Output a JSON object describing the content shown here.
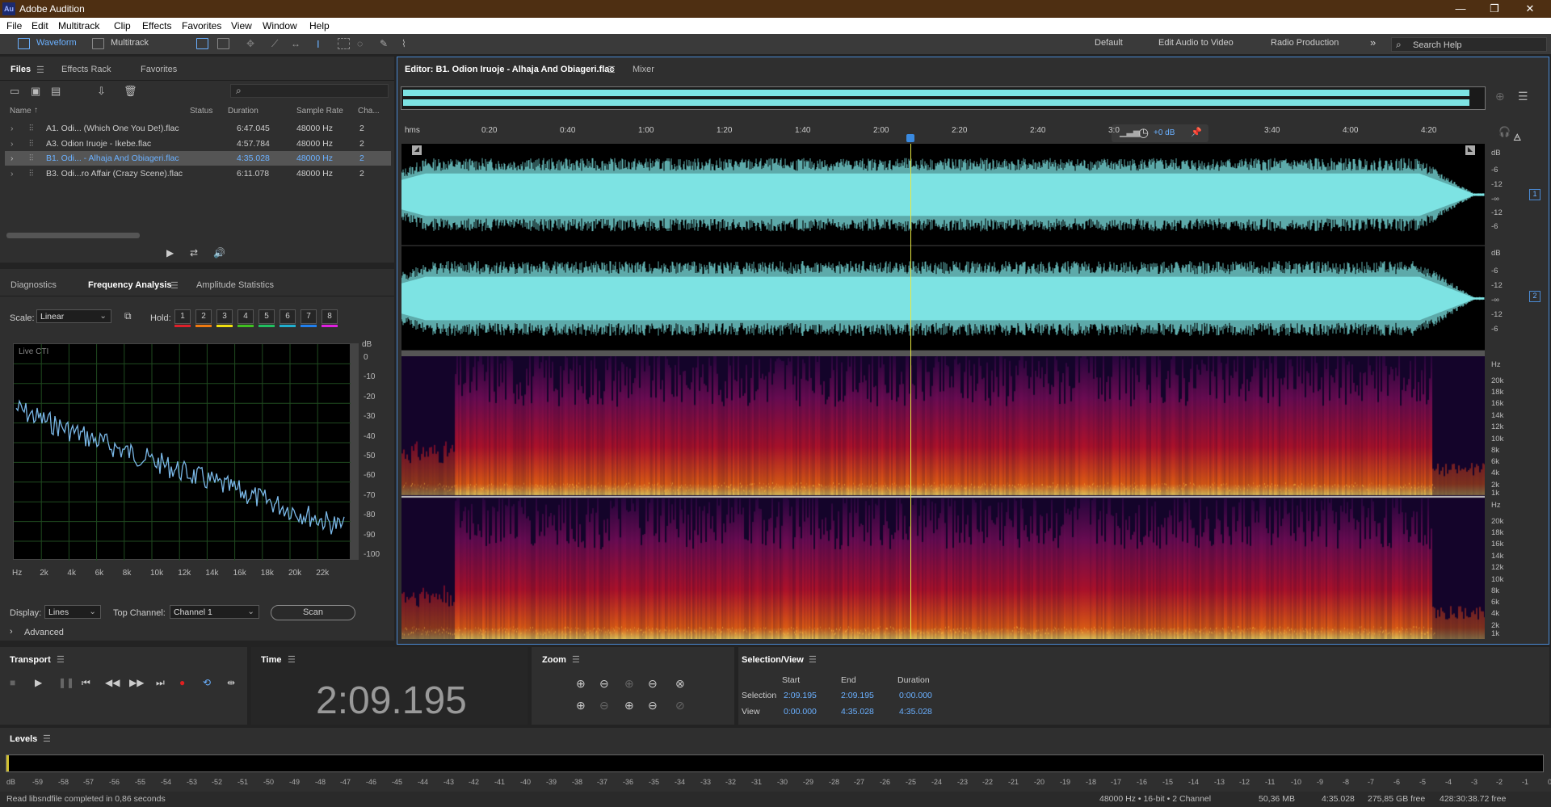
{
  "app": {
    "title": "Adobe Audition",
    "logo_text": "Au",
    "window_buttons": [
      "—",
      "❐",
      "✕"
    ]
  },
  "menu": [
    "File",
    "Edit",
    "Multitrack",
    "Clip",
    "Effects",
    "Favorites",
    "View",
    "Window",
    "Help"
  ],
  "toolbar": {
    "waveform_label": "Waveform",
    "multitrack_label": "Multitrack",
    "workspaces": [
      "Default",
      "Edit Audio to Video",
      "Radio Production"
    ],
    "more": "»",
    "search_placeholder": "Search Help"
  },
  "files_panel": {
    "tabs": [
      "Files",
      "Effects Rack",
      "Favorites"
    ],
    "search_icon": "⌕",
    "columns": [
      "Name",
      "Status",
      "Duration",
      "Sample Rate",
      "Cha..."
    ],
    "sort_arrow": "↑",
    "rows": [
      {
        "name": "A1. Odi... (Which One You De!).flac",
        "duration": "6:47.045",
        "rate": "48000 Hz",
        "ch": "2",
        "selected": false
      },
      {
        "name": "A3. Odion Iruoje - Ikebe.flac",
        "duration": "4:57.784",
        "rate": "48000 Hz",
        "ch": "2",
        "selected": false
      },
      {
        "name": "B1. Odi... - Alhaja And Obiageri.flac",
        "duration": "4:35.028",
        "rate": "48000 Hz",
        "ch": "2",
        "selected": true
      },
      {
        "name": "B3. Odi...ro Affair (Crazy Scene).flac",
        "duration": "6:11.078",
        "rate": "48000 Hz",
        "ch": "2",
        "selected": false
      }
    ]
  },
  "analysis_panel": {
    "tabs": [
      "Diagnostics",
      "Frequency Analysis",
      "Amplitude Statistics"
    ],
    "scale_label": "Scale:",
    "scale_value": "Linear",
    "hold_label": "Hold:",
    "hold_buttons": [
      "1",
      "2",
      "3",
      "4",
      "5",
      "6",
      "7",
      "8"
    ],
    "hold_colors": [
      "#e0202a",
      "#f07a10",
      "#f0e010",
      "#40c020",
      "#20c060",
      "#20b0d0",
      "#2080f0",
      "#e020e0"
    ],
    "live_cti": "Live CTI",
    "db_label": "dB",
    "db_ticks": [
      "0",
      "-10",
      "-20",
      "-30",
      "-40",
      "-50",
      "-60",
      "-70",
      "-80",
      "-90",
      "-100"
    ],
    "hz_ticks": [
      "Hz",
      "2k",
      "4k",
      "6k",
      "8k",
      "10k",
      "12k",
      "14k",
      "16k",
      "18k",
      "20k",
      "22k"
    ],
    "display_label": "Display:",
    "display_value": "Lines",
    "top_channel_label": "Top Channel:",
    "top_channel_value": "Channel 1",
    "scan_label": "Scan",
    "advanced_label": "Advanced"
  },
  "editor": {
    "tab_label": "Editor: B1. Odion Iruoje - Alhaja And Obiageri.flac",
    "mixer_label": "Mixer",
    "timeline_unit": "hms",
    "timeline_ticks": [
      "0:20",
      "0:40",
      "1:00",
      "1:20",
      "1:40",
      "2:00",
      "2:20",
      "2:40",
      "3:0",
      "3:40",
      "4:00",
      "4:20"
    ],
    "hud_gain": "+0 dB",
    "db_scale": [
      "dB",
      "-6",
      "-12",
      "-∞",
      "-12",
      "-6"
    ],
    "hz_scale": [
      "Hz",
      "20k",
      "18k",
      "16k",
      "14k",
      "12k",
      "10k",
      "8k",
      "6k",
      "4k",
      "2k",
      "1k"
    ],
    "channel_badges": [
      "1",
      "2"
    ],
    "playhead_fraction": 0.47
  },
  "transport": {
    "title": "Transport"
  },
  "time_panel": {
    "title": "Time",
    "value": "2:09.195"
  },
  "zoom_panel": {
    "title": "Zoom"
  },
  "selection_view": {
    "title": "Selection/View",
    "columns": [
      "Start",
      "End",
      "Duration"
    ],
    "rows": [
      {
        "label": "Selection",
        "start": "2:09.195",
        "end": "2:09.195",
        "duration": "0:00.000"
      },
      {
        "label": "View",
        "start": "0:00.000",
        "end": "4:35.028",
        "duration": "4:35.028"
      }
    ]
  },
  "levels": {
    "title": "Levels",
    "ticks": [
      "dB",
      "-59",
      "-58",
      "-57",
      "-56",
      "-55",
      "-54",
      "-53",
      "-52",
      "-51",
      "-50",
      "-49",
      "-48",
      "-47",
      "-46",
      "-45",
      "-44",
      "-43",
      "-42",
      "-41",
      "-40",
      "-39",
      "-38",
      "-37",
      "-36",
      "-35",
      "-34",
      "-33",
      "-32",
      "-31",
      "-30",
      "-29",
      "-28",
      "-27",
      "-26",
      "-25",
      "-24",
      "-23",
      "-22",
      "-21",
      "-20",
      "-19",
      "-18",
      "-17",
      "-16",
      "-15",
      "-14",
      "-13",
      "-12",
      "-11",
      "-10",
      "-9",
      "-8",
      "-7",
      "-6",
      "-5",
      "-4",
      "-3",
      "-2",
      "-1",
      "0"
    ]
  },
  "status_bar": {
    "message": "Read libsndfile completed in 0,86 seconds",
    "format": "48000 Hz • 16-bit • 2 Channel",
    "size": "50,36 MB",
    "duration": "4:35.028",
    "free": "275,85 GB free",
    "free_time": "428:30:38.72 free"
  },
  "colors": {
    "waveform": "#7de3e3",
    "accent": "#6ab0ff",
    "titlebar": "#4e2f12",
    "record": "#e02020"
  }
}
